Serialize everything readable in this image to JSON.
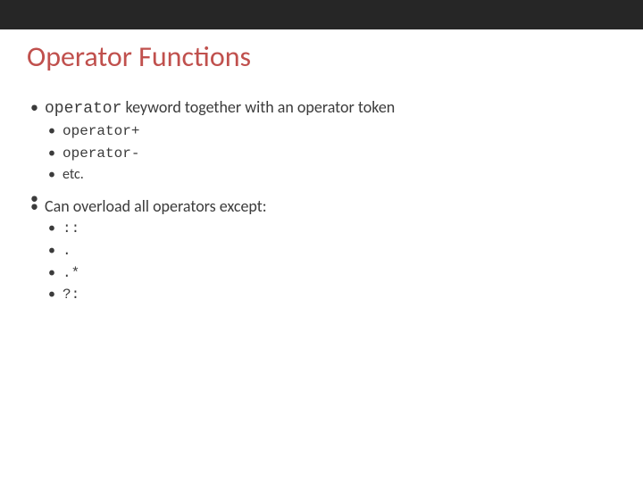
{
  "title": "Operator Functions",
  "bullets": [
    {
      "prefix_code": "operator",
      "suffix_text": " keyword together with an operator token",
      "sub": [
        {
          "code": "operator+"
        },
        {
          "code": "operator-"
        },
        {
          "text": "etc."
        }
      ]
    },
    {
      "text": "Can overload all operators except:",
      "sub": [
        {
          "code": "::"
        },
        {
          "code": "."
        },
        {
          "code": ".*"
        },
        {
          "code": "?:"
        }
      ]
    }
  ]
}
